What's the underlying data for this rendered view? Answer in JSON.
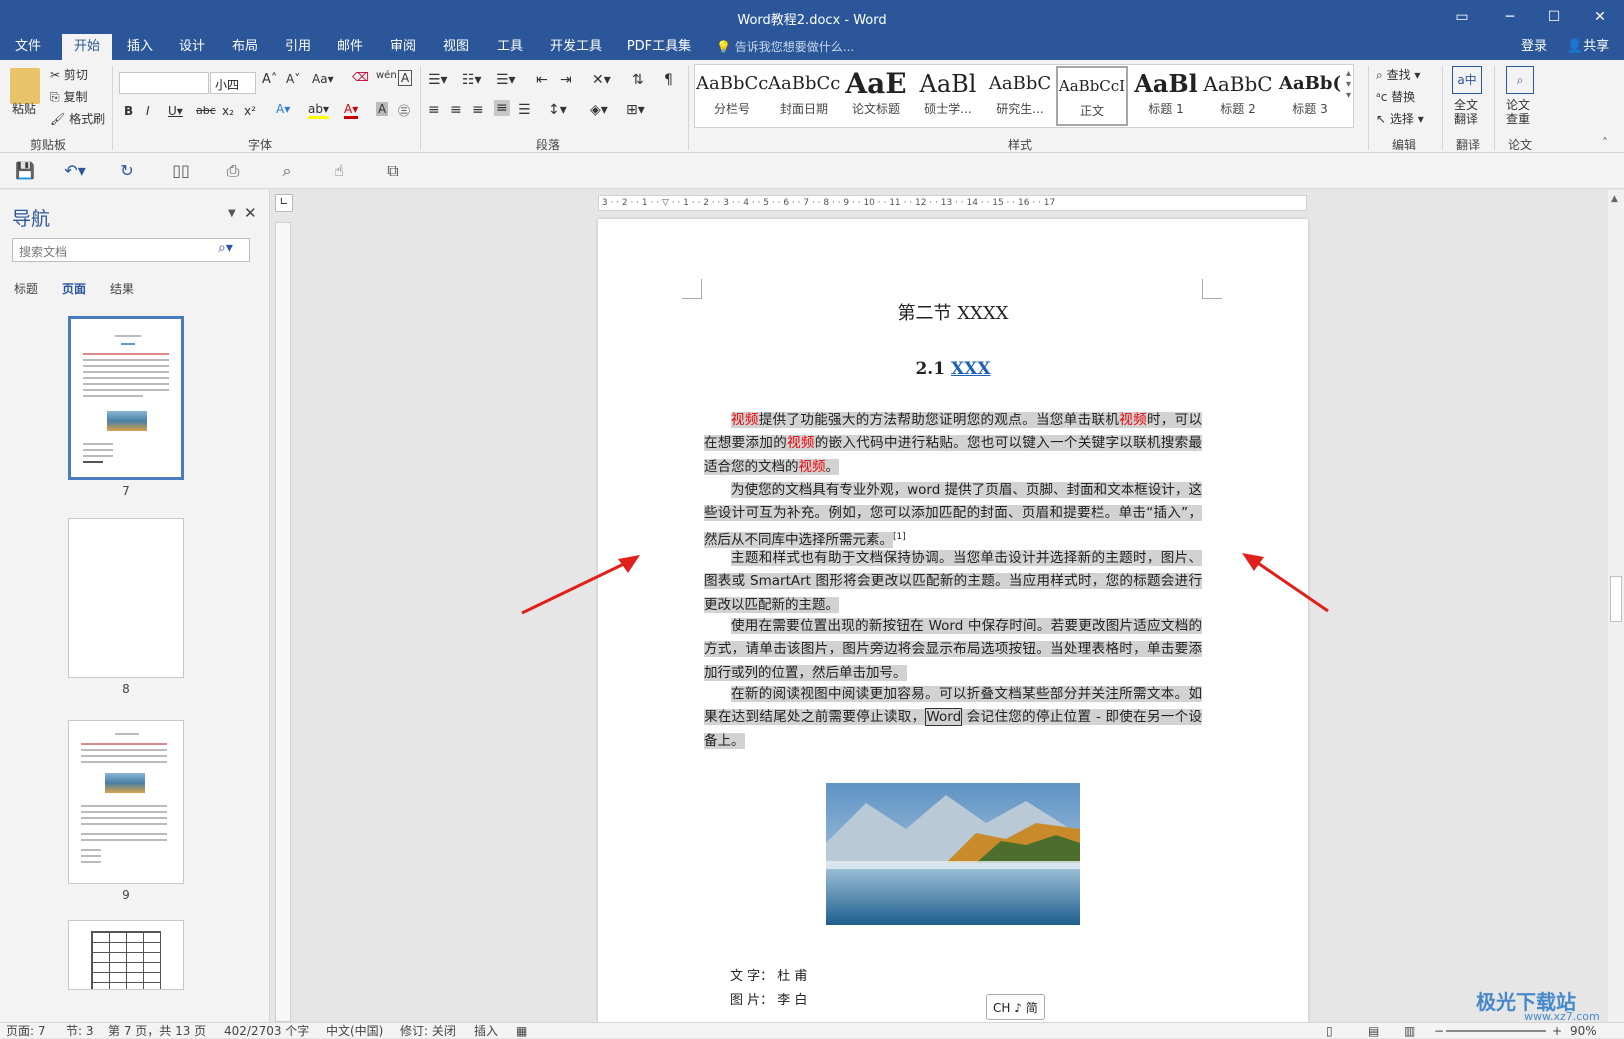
{
  "window": {
    "title": "Word教程2.docx - Word"
  },
  "menu": {
    "tabs": [
      "文件",
      "开始",
      "插入",
      "设计",
      "布局",
      "引用",
      "邮件",
      "审阅",
      "视图",
      "工具",
      "开发工具",
      "PDF工具集"
    ],
    "tell_me": "告诉我您想要做什么...",
    "login": "登录",
    "share": "共享"
  },
  "ribbon": {
    "clipboard": {
      "paste": "粘贴",
      "cut": "剪切",
      "copy": "复制",
      "format_painter": "格式刷",
      "label": "剪贴板"
    },
    "font": {
      "name": "",
      "size": "小四",
      "label": "字体"
    },
    "paragraph": {
      "label": "段落"
    },
    "styles": {
      "label": "样式",
      "items": [
        {
          "sample": "AaBbCc",
          "name": "分栏号"
        },
        {
          "sample": "AaBbCc",
          "name": "封面日期"
        },
        {
          "sample": "AaE",
          "name": "论文标题"
        },
        {
          "sample": "AaBl",
          "name": "硕士学..."
        },
        {
          "sample": "AaBbC",
          "name": "研究生..."
        },
        {
          "sample": "AaBbCcI",
          "name": "正文"
        },
        {
          "sample": "AaBl",
          "name": "标题 1"
        },
        {
          "sample": "AaBbC",
          "name": "标题 2"
        },
        {
          "sample": "AaBb(",
          "name": "标题 3"
        }
      ]
    },
    "editing": {
      "find": "查找",
      "replace": "替换",
      "select": "选择",
      "label": "编辑"
    },
    "translate": {
      "btn": "全文\n翻译",
      "label": "翻译"
    },
    "paper": {
      "btn": "论文\n查重",
      "label": "论文"
    }
  },
  "nav": {
    "title": "导航",
    "search_placeholder": "搜索文档",
    "tabs": [
      "标题",
      "页面",
      "结果"
    ],
    "pages": [
      "7",
      "8",
      "9"
    ]
  },
  "document": {
    "section_title": "第二节  XXXX",
    "heading_num": "2.1",
    "heading_text": "XXX",
    "p1": [
      {
        "t": "视频",
        "red": true
      },
      {
        "t": "提供了功能强大的方法帮助您证明您的观点。当您单击联机"
      },
      {
        "t": "视频",
        "red": true
      },
      {
        "t": "时，可以在想要添加的"
      },
      {
        "t": "视频",
        "red": true
      },
      {
        "t": "的嵌入代码中进行粘贴。您也可以键入一个关键字以联机搜索最适合您的文档的"
      },
      {
        "t": "视频",
        "red": true
      },
      {
        "t": "。"
      }
    ],
    "p2": "为使您的文档具有专业外观，word 提供了页眉、页脚、封面和文本框设计，这些设计可互为补充。例如，您可以添加匹配的封面、页眉和提要栏。单击“插入”，然后从不同库中选择所需元素。",
    "p2_ref": "[1]",
    "p3": "主题和样式也有助于文档保持协调。当您单击设计并选择新的主题时，图片、图表或 SmartArt 图形将会更改以匹配新的主题。当应用样式时，您的标题会进行更改以匹配新的主题。",
    "p4": "使用在需要位置出现的新按钮在 Word 中保存时间。若要更改图片适应文档的方式，请单击该图片，图片旁边将会显示布局选项按钮。当处理表格时，单击要添加行或列的位置，然后单击加号。",
    "p5a": "在新的阅读视图中阅读更加容易。可以折叠文档某些部分并关注所需文本。如果在达到结尾处之前需要停止读取，",
    "p5_word": "Word",
    "p5b": " 会记住您的停止位置 - 即使在另一个设备上。",
    "credit1": "文  字：  杜      甫",
    "credit2": "图  片：  李      白"
  },
  "ime": "CH ♪ 简",
  "status": {
    "page": "页面: 7",
    "section": "节: 3",
    "pages": "第 7 页，共 13 页",
    "words": "402/2703 个字",
    "lang": "中文(中国)",
    "track": "修订: 关闭",
    "mode": "插入",
    "zoom": "90%"
  },
  "watermark": "极光下载站",
  "watermark_url": "www.xz7.com"
}
